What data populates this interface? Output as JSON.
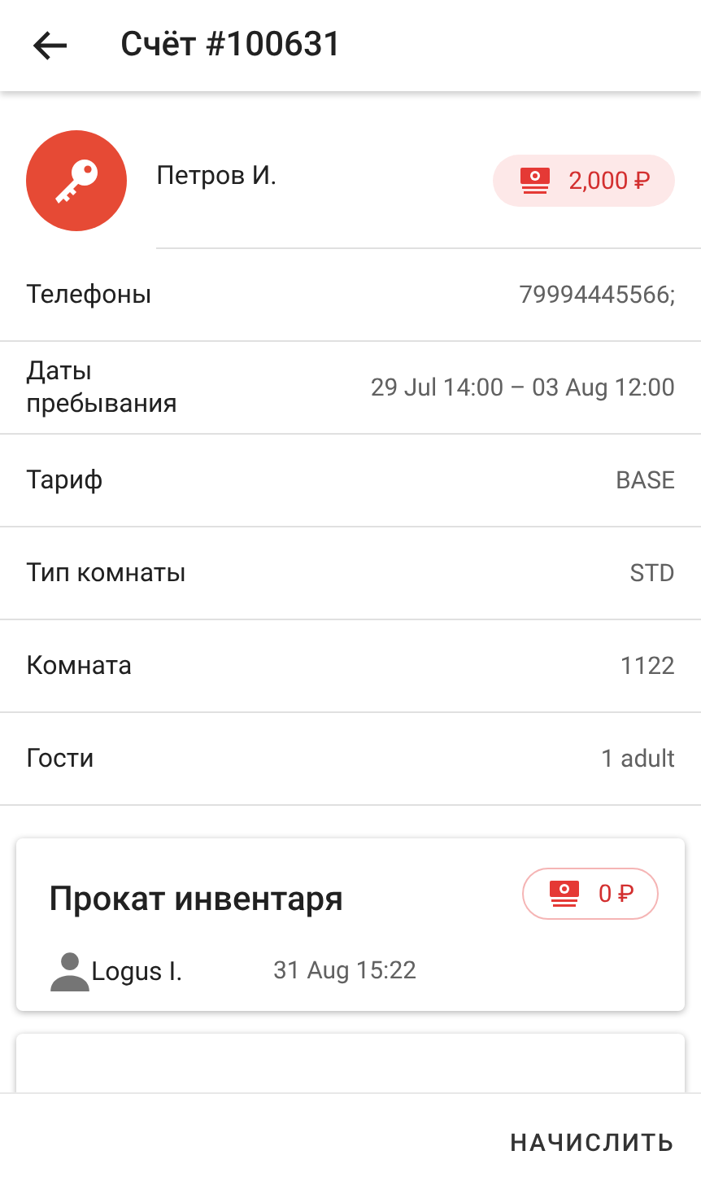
{
  "header": {
    "title": "Счёт #100631"
  },
  "guest": {
    "name": "Петров И.",
    "balance": {
      "kind": "filled",
      "amount": "2,000 ₽"
    }
  },
  "details": [
    {
      "label": "Телефоны",
      "value": "79994445566;"
    },
    {
      "label": "Даты пребывания",
      "value": "29 Jul 14:00 – 03 Aug 12:00"
    },
    {
      "label": "Тариф",
      "value": "BASE"
    },
    {
      "label": "Тип комнаты",
      "value": "STD"
    },
    {
      "label": "Комната",
      "value": "1122"
    },
    {
      "label": "Гости",
      "value": "1 adult"
    }
  ],
  "services": [
    {
      "title": "Прокат инвентаря",
      "balance": {
        "kind": "outlined",
        "amount": "0 ₽"
      },
      "author": "Logus I.",
      "time": "31 Aug 15:22"
    }
  ],
  "actions": [
    "НАЧИСЛИТЬ"
  ]
}
